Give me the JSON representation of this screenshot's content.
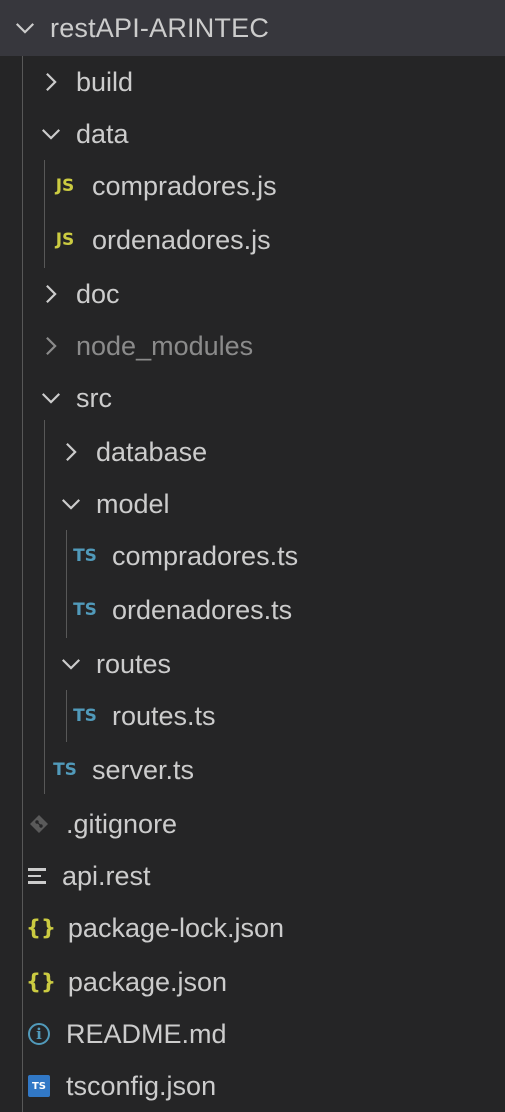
{
  "explorer": {
    "root_label": "restAPI-ARINTEC",
    "items": [
      {
        "label": "build",
        "type": "folder",
        "expanded": false
      },
      {
        "label": "data",
        "type": "folder",
        "expanded": true
      },
      {
        "label": "compradores.js",
        "type": "js",
        "icon_text": "JS"
      },
      {
        "label": "ordenadores.js",
        "type": "js",
        "icon_text": "JS"
      },
      {
        "label": "doc",
        "type": "folder",
        "expanded": false
      },
      {
        "label": "node_modules",
        "type": "folder",
        "expanded": false,
        "dimmed": true
      },
      {
        "label": "src",
        "type": "folder",
        "expanded": true
      },
      {
        "label": "database",
        "type": "folder",
        "expanded": false
      },
      {
        "label": "model",
        "type": "folder",
        "expanded": true
      },
      {
        "label": "compradores.ts",
        "type": "ts",
        "icon_text": "TS"
      },
      {
        "label": "ordenadores.ts",
        "type": "ts",
        "icon_text": "TS"
      },
      {
        "label": "routes",
        "type": "folder",
        "expanded": true
      },
      {
        "label": "routes.ts",
        "type": "ts",
        "icon_text": "TS"
      },
      {
        "label": "server.ts",
        "type": "ts",
        "icon_text": "TS"
      },
      {
        "label": ".gitignore",
        "type": "git"
      },
      {
        "label": "api.rest",
        "type": "rest"
      },
      {
        "label": "package-lock.json",
        "type": "json",
        "icon_text": "{}"
      },
      {
        "label": "package.json",
        "type": "json",
        "icon_text": "{}"
      },
      {
        "label": "README.md",
        "type": "readme",
        "icon_text": "i"
      },
      {
        "label": "tsconfig.json",
        "type": "tsconfig",
        "icon_text": "TS"
      }
    ]
  },
  "colors": {
    "background": "#252526",
    "root_background": "#37373d",
    "text": "#cccccc",
    "dim_text": "#8b8b8b",
    "js_yellow": "#cbcb41",
    "ts_blue": "#519aba",
    "tsconfig_blue": "#3178c6"
  }
}
